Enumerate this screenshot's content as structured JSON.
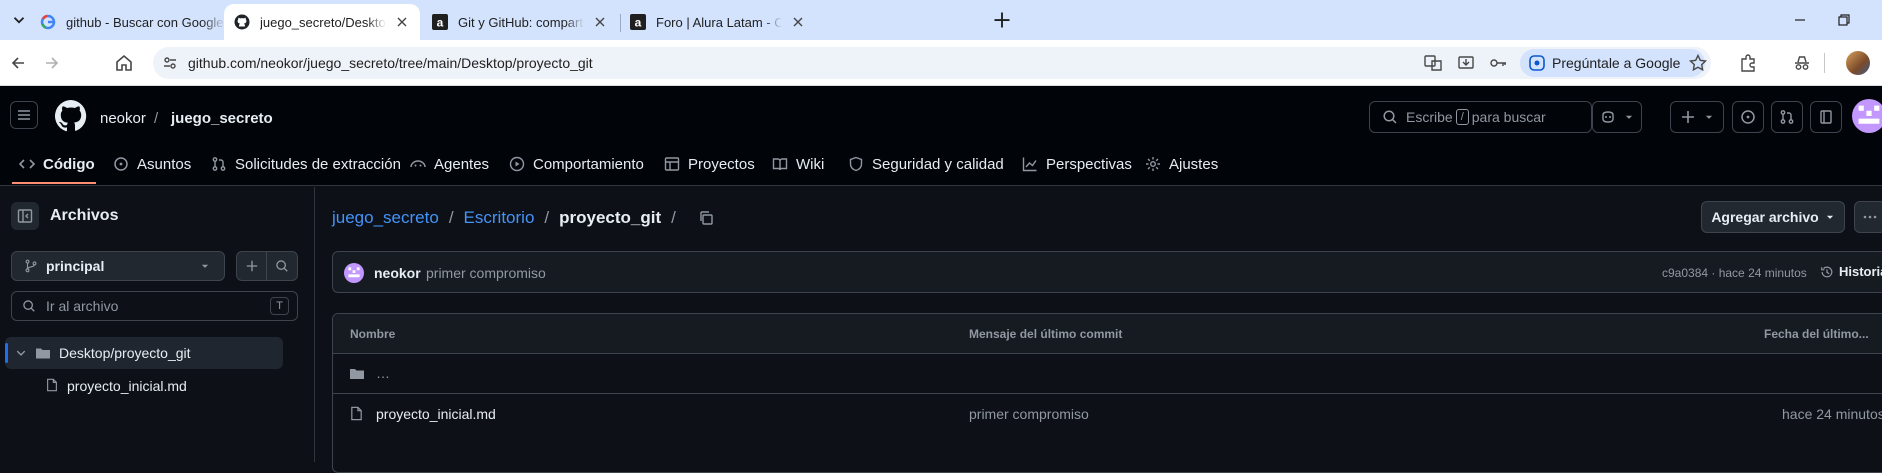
{
  "browser": {
    "tabs": [
      {
        "title": "github - Buscar con Google",
        "icon": "google-icon",
        "active": false
      },
      {
        "title": "juego_secreto/Desktop/proyecto_git",
        "icon": "github-icon",
        "active": true
      },
      {
        "title": "Git y GitHub: compartiendo y colaborando",
        "icon": "alura-icon",
        "active": false
      },
      {
        "title": "Foro | Alura Latam - Cursos online",
        "icon": "alura-icon",
        "active": false
      }
    ],
    "url": "github.com/neokor/juego_secreto/tree/main/Desktop/proyecto_git",
    "ask_google": "Pregúntale a Google"
  },
  "header": {
    "owner": "neokor",
    "separator": "/",
    "repo": "juego_secreto",
    "search_placeholder_pre": "Escribe",
    "search_key": "/",
    "search_placeholder_post": "para buscar"
  },
  "nav": [
    {
      "label": "Código",
      "icon": "code-icon"
    },
    {
      "label": "Asuntos",
      "icon": "issue-icon"
    },
    {
      "label": "Solicitudes de extracción",
      "icon": "pull-request-icon"
    },
    {
      "label": "Agentes",
      "icon": "agent-icon"
    },
    {
      "label": "Comportamiento",
      "icon": "play-icon"
    },
    {
      "label": "Proyectos",
      "icon": "table-icon"
    },
    {
      "label": "Wiki",
      "icon": "book-icon"
    },
    {
      "label": "Seguridad y calidad",
      "icon": "shield-icon"
    },
    {
      "label": "Perspectivas",
      "icon": "graph-icon"
    },
    {
      "label": "Ajustes",
      "icon": "gear-icon"
    }
  ],
  "sidebar": {
    "title": "Archivos",
    "branch": "principal",
    "filter_placeholder": "Ir al archivo",
    "filter_key": "T",
    "tree": {
      "folder": "Desktop/proyecto_git",
      "file": "proyecto_inicial.md"
    }
  },
  "breadcrumb": {
    "root": "juego_secreto",
    "sep": "/",
    "mid": "Escritorio",
    "current": "proyecto_git",
    "trail": "/"
  },
  "add_file": "Agregar archivo",
  "commit": {
    "author": "neokor",
    "message": "primer compromiso",
    "sha_time": "c9a0384 · hace 24 minutos",
    "history": "Historia"
  },
  "table": {
    "headers": [
      "Nombre",
      "Mensaje del último commit",
      "Fecha del último..."
    ],
    "parent_row": "…",
    "rows": [
      {
        "name": "proyecto_inicial.md",
        "message": "primer compromiso",
        "date": "hace 24 minutos"
      }
    ]
  }
}
